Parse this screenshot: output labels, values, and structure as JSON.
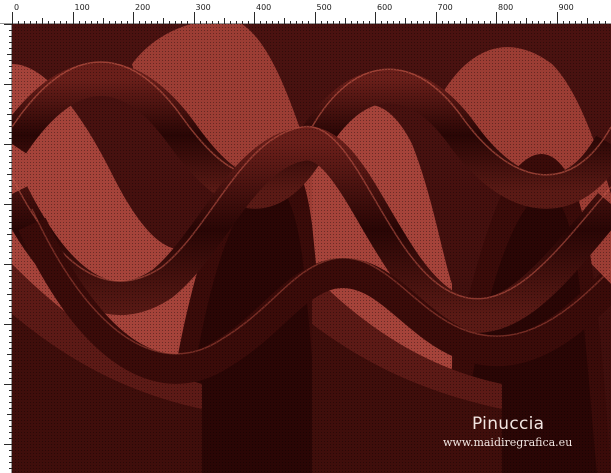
{
  "ruler": {
    "labels": [
      "0",
      "100",
      "200",
      "300",
      "400",
      "500",
      "600",
      "700",
      "800",
      "900"
    ]
  },
  "artwork": {
    "watermark_name": "Pinuccia",
    "watermark_url": "www.maidiregrafica.eu",
    "colors": {
      "background": "#4a1512",
      "terracotta": "#a54238",
      "band_dark": "#2a0605",
      "band_mid": "#5c1a16",
      "band_deep": "#3a0b09",
      "highlight": "#c45a4a"
    }
  }
}
